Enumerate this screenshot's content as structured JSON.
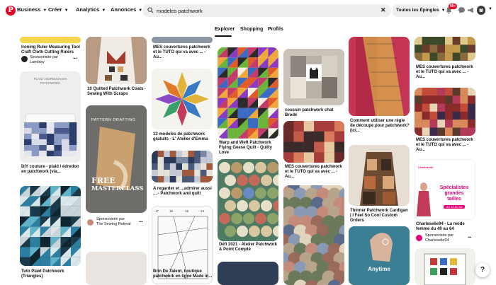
{
  "nav": {
    "business": "Business",
    "creer": "Créer",
    "analytics": "Analytics",
    "annonces": "Annonces",
    "filter": "Toutes les Épingles",
    "badge": "99+"
  },
  "search": {
    "value": "modeles patchwork"
  },
  "tabs": {
    "explorer": "Explorer",
    "shopping": "Shopping",
    "profils": "Profils"
  },
  "pins": {
    "col1": {
      "p1_title": "Ironing Ruler Measuring Tool Craft Cloth Cutting Rulers",
      "p1_sponsor": "Sponsorisée par",
      "p1_brand": "Lambtsy",
      "p2_overlay": "PLAID / ÉDREDON EN PATCHWORK",
      "p2_title": "DIY couture - plaid / édredon en patchwork (via...",
      "p3_title": "Tuto Plaid Patchwork (Triangles)"
    },
    "col2": {
      "p1_title": "10 Quilted Patchwork Coats - Sewing With Scraps",
      "p2_top": "PATTERN DRAFTING",
      "p2_free": "FREE",
      "p2_master": "MASTERCLASS",
      "p2_sponsor": "Sponsorisée par",
      "p2_brand": "The Sewing Retreat"
    },
    "col3": {
      "p0_title": "MES couvertures patchwork et le TUTO qui va avec ... - Au...",
      "p1_title": "13 modeles de patchwork gratuits - L' Atelier d'Emma",
      "p2_title": "A regarder et ...admirer aussi ... - Patchwork and quilt",
      "p3_title": "Brin De Talent, boutique patchwork en ligne Made in...",
      "p3_numbers": [
        "17",
        "16",
        "15",
        "14"
      ]
    },
    "col4": {
      "p1_title": "Warp and Weft Patchwork Flying Geese Quilt - Quilty Love",
      "p2_title": "Défi 2021 - Atelier Patchwork & Point Compté"
    },
    "col5": {
      "p1_title": "coussin patchwork chat Brodé",
      "p2_title": "MES couvertures patchwork et le TUTO qui va avec ... - Au..."
    },
    "col6": {
      "p1_title": "Comment utiliser une règle de découpe pour patchwork? (ici...",
      "p2_title": "Thinner Patchwork Cardigan | I Feel So Cool Custom Orders",
      "p3_overlay": "Anytime"
    },
    "col7": {
      "p0_title": "MES couvertures patchwork et le TUTO qui va avec ... - Au...",
      "p1_title": "MES couvertures patchwork et le TUTO qui va avec ... - Au...",
      "p2_brand_top": "Charleselie",
      "p2_headline1": "Spécialistes grandes",
      "p2_headline2": "tailles",
      "p2_range": "DU 40 AU 64",
      "p2_title": "Charleselie94 - La mode femme du 40 au 64",
      "p2_sponsor": "Sponsorisée par",
      "p2_brand": "Charleselie94"
    }
  },
  "help": "?",
  "colors": {
    "brand": "#e60023",
    "search_bg": "#efefef"
  }
}
